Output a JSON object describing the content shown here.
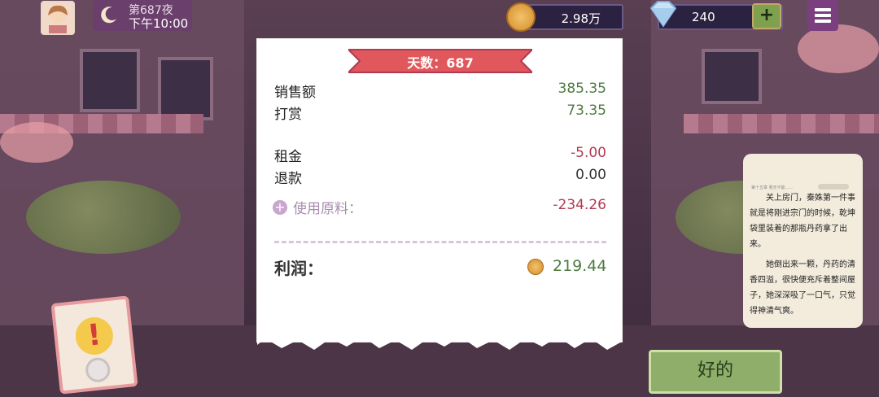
{
  "hud": {
    "night_label": "第687夜",
    "time_label": "下午10:00",
    "coins": "2.98万",
    "gems": "240",
    "plus_label": "+"
  },
  "receipt": {
    "day_label": "天数：687",
    "rows": [
      {
        "label": "销售额",
        "value": "385.35"
      },
      {
        "label": "打赏",
        "value": "73.35"
      },
      {
        "label": "租金",
        "value": "-5.00"
      },
      {
        "label": "退款",
        "value": "0.00"
      }
    ],
    "materials_label": "使用原料：",
    "materials_value": "-234.26",
    "profit_label": "利润：",
    "profit_value": "219.44"
  },
  "reader": {
    "header": "第十五章 我无不能……",
    "paragraph1": "关上房门，秦姝第一件事就是将刚进宗门的时候，乾坤袋里装着的那瓶丹药拿了出来。",
    "paragraph2": "她倒出来一颗，丹药的清香四溢，很快便充斥着整间屋子，她深深吸了一口气，只觉得神清气爽。"
  },
  "actions": {
    "ok_label": "好的"
  },
  "colors": {
    "profit_green": "#4e7a41",
    "negative_red": "#b03a52",
    "banner_red": "#e0585c",
    "ok_button_green": "#8fae6a"
  },
  "icons": [
    "moon-icon",
    "coin-icon",
    "gem-icon",
    "plus-icon",
    "menu-icon",
    "alert-icon"
  ]
}
